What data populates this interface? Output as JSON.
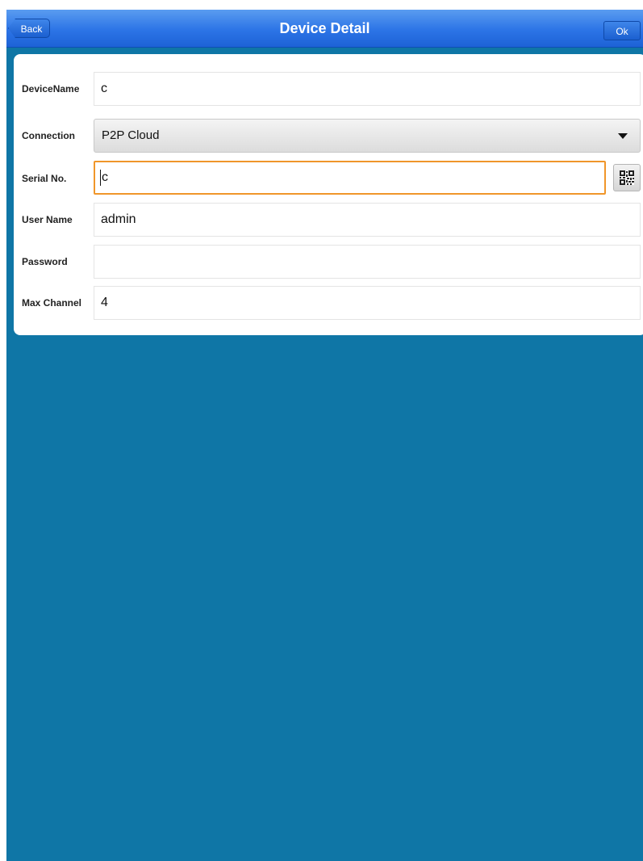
{
  "nav": {
    "back_label": "Back",
    "title": "Device Detail",
    "ok_label": "Ok"
  },
  "form": {
    "device_name": {
      "label": "DeviceName",
      "value": "c"
    },
    "connection": {
      "label": "Connection",
      "value": "P2P Cloud"
    },
    "serial_no": {
      "label": "Serial No.",
      "value": "c",
      "scan_icon": "qr-code-icon"
    },
    "user_name": {
      "label": "User Name",
      "value": "admin"
    },
    "password": {
      "label": "Password",
      "value": ""
    },
    "max_channel": {
      "label": "Max Channel",
      "value": "4"
    }
  },
  "colors": {
    "background": "#0f76a6",
    "nav_bar": "#2c74e6",
    "focus_border": "#f0962a"
  }
}
